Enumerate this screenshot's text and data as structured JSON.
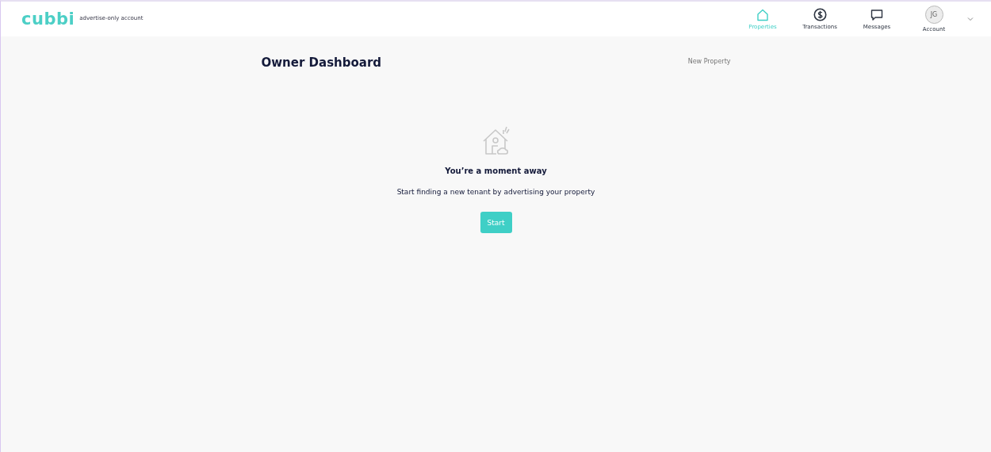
{
  "header": {
    "logo": "cubbi",
    "account_type": "advertise-only account",
    "nav": [
      {
        "label": "Properties",
        "kind": "house",
        "selected": true
      },
      {
        "label": "Transactions",
        "kind": "dollar",
        "selected": false
      },
      {
        "label": "Messages",
        "kind": "chat",
        "selected": false
      },
      {
        "label": "Account",
        "kind": "avatar",
        "initials": "JG",
        "selected": false
      }
    ]
  },
  "page": {
    "title": "Owner Dashboard",
    "action": "New Property"
  },
  "empty_state": {
    "heading": "You’re a moment away",
    "text": "Start finding a new tenant by advertising your property",
    "button": "Start"
  }
}
